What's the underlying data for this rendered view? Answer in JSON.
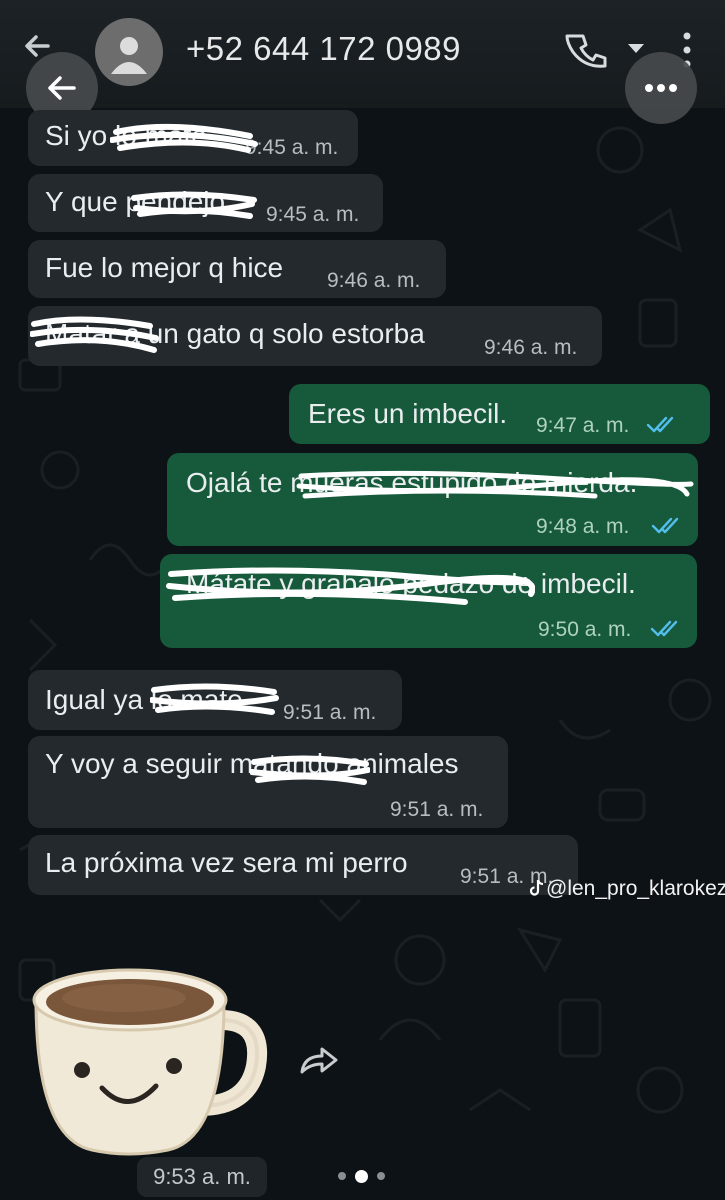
{
  "header": {
    "contact_number": "+52 644 172 0989",
    "icons": [
      "arrow-left-icon",
      "avatar-icon",
      "phone-icon",
      "chevron-down-icon",
      "more-vertical-icon"
    ]
  },
  "messages": [
    {
      "dir": "in",
      "text": "Si yo lo mate",
      "time": "9:45 a. m."
    },
    {
      "dir": "in",
      "text": "Y que pendejo",
      "time": "9:45 a. m."
    },
    {
      "dir": "in",
      "text": "Fue lo mejor q hice",
      "time": "9:46 a. m."
    },
    {
      "dir": "in",
      "text": "Matar a un gato q solo estorba",
      "time": "9:46 a. m."
    },
    {
      "dir": "out",
      "text": "Eres un imbecil.",
      "time": "9:47 a. m.",
      "read": true
    },
    {
      "dir": "out",
      "text": "Ojalá te mueras estúpido de mierda.",
      "time": "9:48 a. m.",
      "read": true
    },
    {
      "dir": "out",
      "text": "Mátate y grabalo pedazo de imbecil.",
      "time": "9:50 a. m.",
      "read": true
    },
    {
      "dir": "in",
      "text": "Igual ya lo mate",
      "time": "9:51 a. m."
    },
    {
      "dir": "in",
      "text": "Y voy a seguir matando animales",
      "time": "9:51 a. m."
    },
    {
      "dir": "in",
      "text": "La próxima vez sera mi perro",
      "time": "9:51 a. m."
    }
  ],
  "sticker": {
    "description_icon": "smiling-coffee-cup-sticker",
    "time": "9:53 a. m."
  },
  "watermark": "@len_pro_klarokezi",
  "pager": {
    "count": 3,
    "active": 1
  },
  "colors": {
    "incoming_bubble": "#23292d",
    "outgoing_bubble": "#165a3b",
    "read_ticks": "#53bdeb",
    "background": "#0d1216"
  }
}
